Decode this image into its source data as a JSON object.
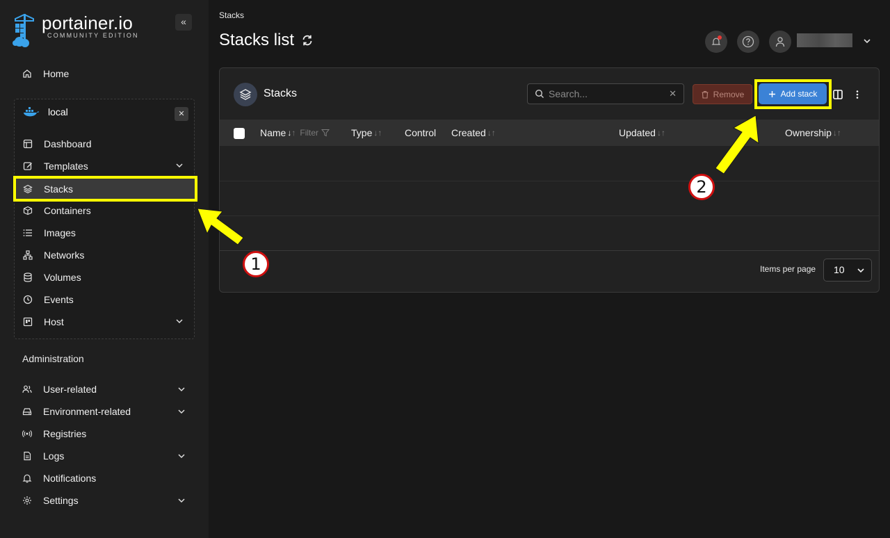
{
  "brand": {
    "name": "portainer.io",
    "edition": "COMMUNITY EDITION"
  },
  "sidebar": {
    "home": "Home",
    "environment": {
      "name": "local",
      "close": "✕",
      "items": [
        {
          "label": "Dashboard",
          "icon": "dashboard-icon"
        },
        {
          "label": "Templates",
          "icon": "edit-icon",
          "expandable": true
        },
        {
          "label": "Stacks",
          "icon": "layers-icon",
          "active": true
        },
        {
          "label": "Containers",
          "icon": "box-icon"
        },
        {
          "label": "Images",
          "icon": "list-icon"
        },
        {
          "label": "Networks",
          "icon": "network-icon"
        },
        {
          "label": "Volumes",
          "icon": "database-icon"
        },
        {
          "label": "Events",
          "icon": "clock-icon"
        },
        {
          "label": "Host",
          "icon": "host-icon",
          "expandable": true
        }
      ]
    },
    "admin_label": "Administration",
    "admin_items": [
      {
        "label": "User-related",
        "icon": "users-icon",
        "expandable": true
      },
      {
        "label": "Environment-related",
        "icon": "drive-icon",
        "expandable": true
      },
      {
        "label": "Registries",
        "icon": "radio-icon"
      },
      {
        "label": "Logs",
        "icon": "file-icon",
        "expandable": true
      },
      {
        "label": "Notifications",
        "icon": "bell-icon"
      },
      {
        "label": "Settings",
        "icon": "gear-icon",
        "expandable": true
      }
    ]
  },
  "header": {
    "breadcrumb": "Stacks",
    "title": "Stacks list"
  },
  "panel": {
    "title": "Stacks",
    "search_placeholder": "Search...",
    "remove_label": "Remove",
    "add_label": "Add stack",
    "columns": {
      "name": "Name",
      "filter": "Filter",
      "type": "Type",
      "control": "Control",
      "created": "Created",
      "updated": "Updated",
      "ownership": "Ownership"
    },
    "items_per_page_label": "Items per page",
    "items_per_page": "10"
  },
  "annotations": {
    "step1": "1",
    "step2": "2"
  },
  "colors": {
    "highlight": "#ffff00",
    "primary": "#3b82d6",
    "danger": "#5c2a22",
    "step_ring": "#d01010"
  }
}
